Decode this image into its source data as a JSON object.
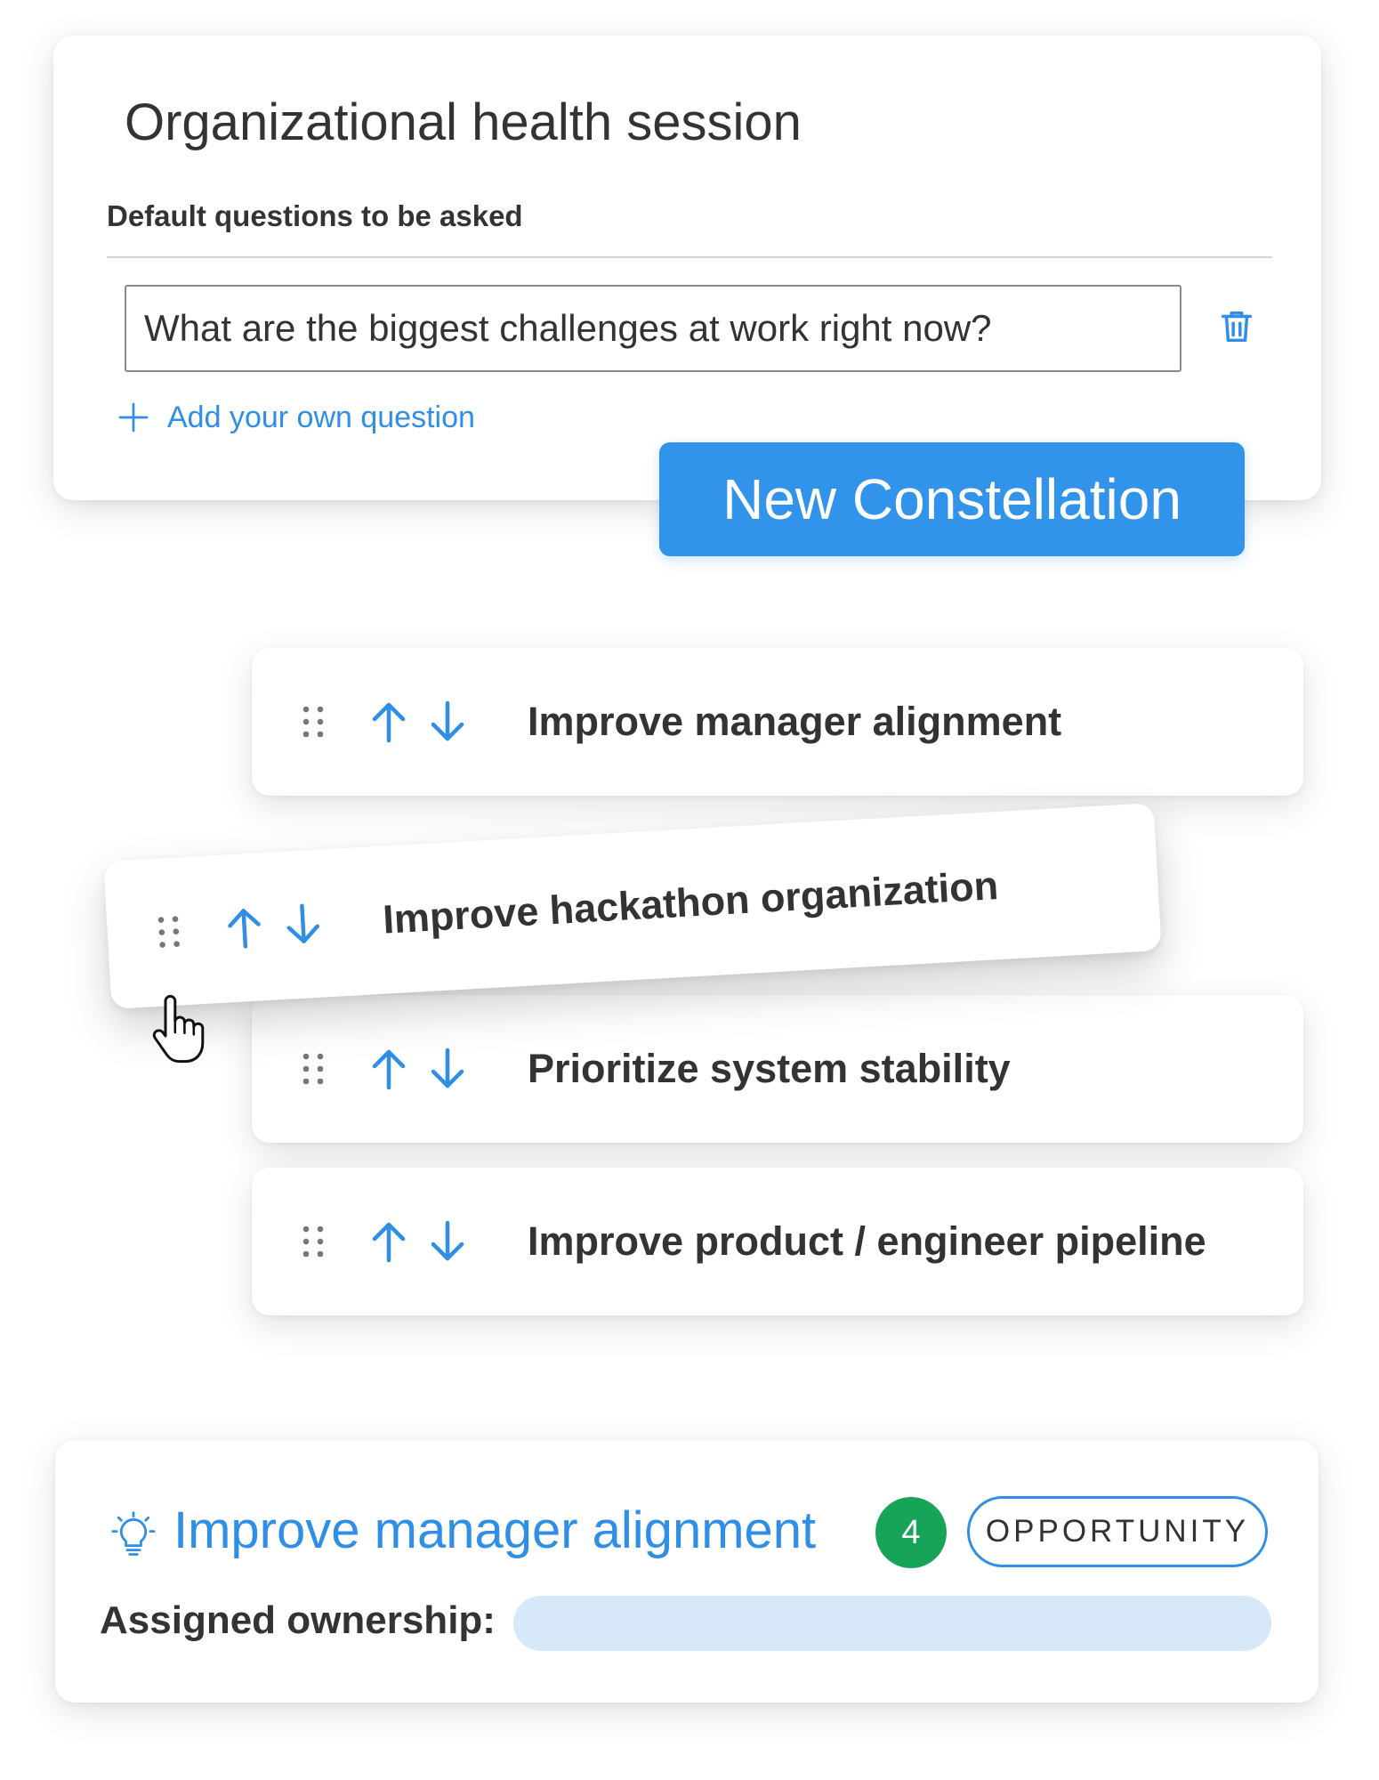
{
  "session": {
    "title": "Organizational health session",
    "section_label": "Default questions to be asked",
    "question_value": "What are the biggest challenges at work right now?",
    "add_question_label": "Add your own question"
  },
  "new_constellation_button": {
    "label": "New Constellation"
  },
  "priorities": {
    "items": [
      {
        "label": "Improve manager alignment"
      },
      {
        "label": "Improve hackathon organization"
      },
      {
        "label": "Prioritize system stability"
      },
      {
        "label": "Improve product / engineer pipeline"
      }
    ],
    "dragging_item_index": 1
  },
  "opportunity": {
    "title": "Improve manager alignment",
    "count": "4",
    "type_label": "OPPORTUNITY",
    "ownership_label": "Assigned ownership:"
  },
  "icons": {
    "delete": "trash-icon",
    "add": "plus-icon",
    "drag": "drag-handle-icon",
    "move_up": "arrow-up-icon",
    "move_down": "arrow-down-icon",
    "pointer": "hand-cursor-icon",
    "idea": "lightbulb-icon"
  },
  "colors": {
    "accent_blue": "#3193ea",
    "link_blue": "#2f8ee5",
    "badge_green": "#18a458",
    "field_blue": "#d7e8f9",
    "text_dark": "#333333"
  }
}
